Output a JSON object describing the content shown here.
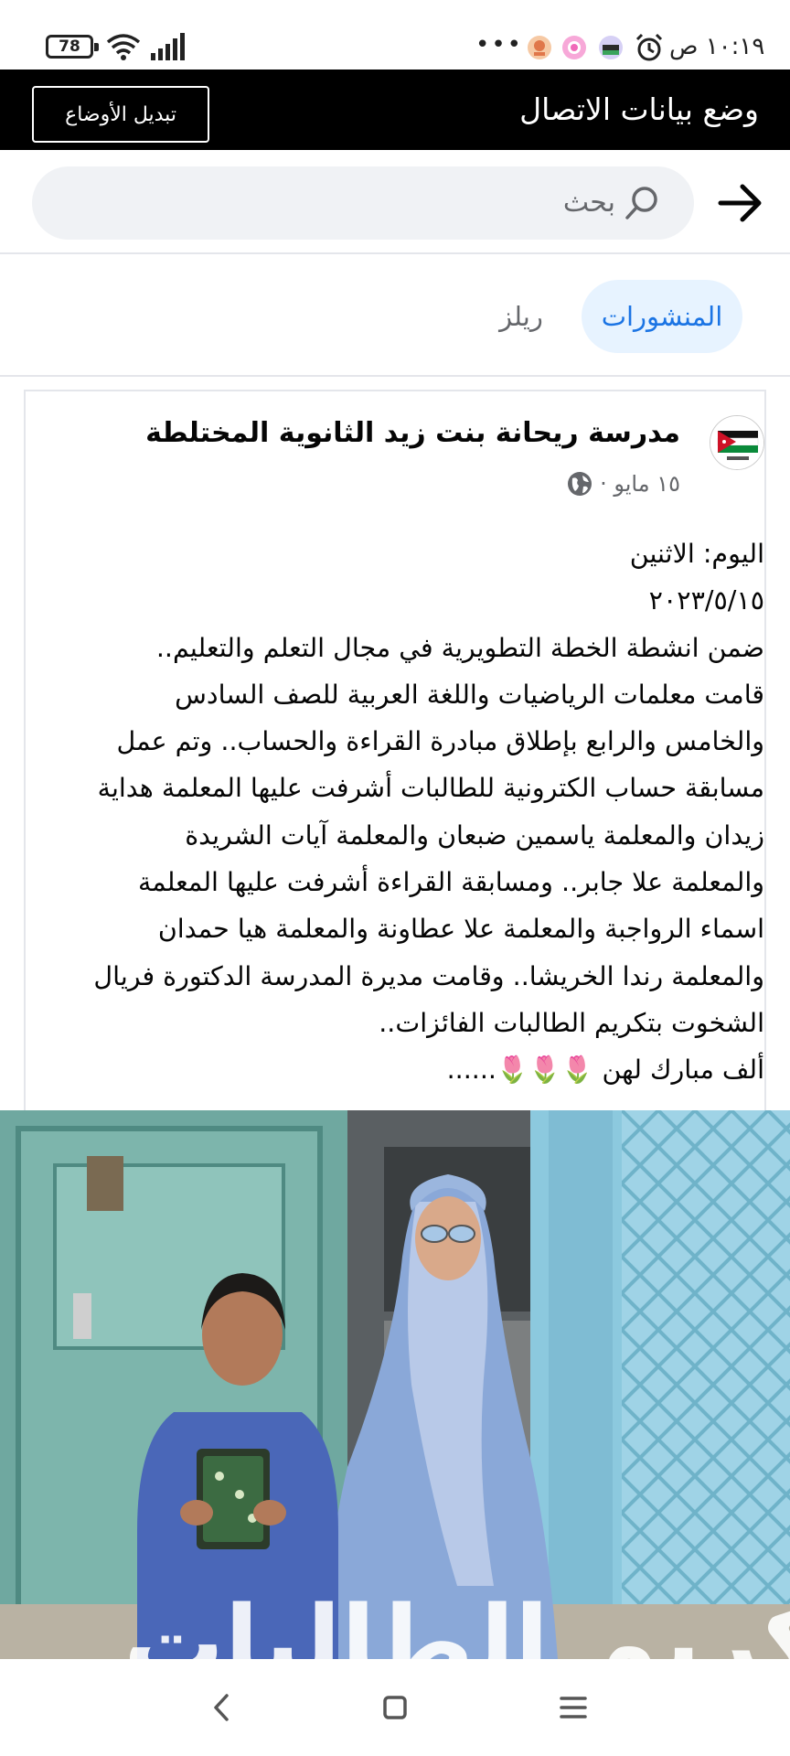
{
  "status_bar": {
    "time": "١٠:١٩ ص",
    "battery": "78",
    "more": "•••",
    "icons": [
      "alarm-icon",
      "app-icon",
      "app-icon",
      "app-icon",
      "wifi-icon",
      "signal-icon",
      "battery-icon"
    ]
  },
  "banner": {
    "title": "وضع بيانات الاتصال",
    "toggle_label": "تبديل الأوضاع"
  },
  "search": {
    "placeholder": "بحث"
  },
  "tabs": [
    {
      "label": "المنشورات",
      "active": true
    },
    {
      "label": "ريلز",
      "active": false
    }
  ],
  "post": {
    "author": "مدرسة ريحانة بنت زيد الثانوية المختلطة",
    "date": "١٥ مايو ·",
    "body": "اليوم: الاثنين\n٢٠٢٣/٥/١٥\nضمن انشطة الخطة التطويرية في مجال التعلم والتعليم..\nقامت معلمات الرياضيات واللغة العربية للصف السادس\nوالخامس والرابع بإطلاق مبادرة القراءة والحساب.. وتم عمل\nمسابقة حساب الكترونية للطالبات أشرفت عليها المعلمة هداية\nزيدان والمعلمة ياسمين ضبعان والمعلمة آيات الشريدة\nوالمعلمة علا جابر.. ومسابقة القراءة أشرفت عليها المعلمة\nاسماء الرواجبة  والمعلمة علا عطاونة والمعلمة هيا حمدان\nوالمعلمة رندا الخريشا.. وقامت مديرة المدرسة الدكتورة فريال\nالشخوت  بتكريم الطالبات الفائزات..\nألف مبارك لهن 🌷🌷🌷......",
    "photo_caption": "بتكريم الطالبات"
  },
  "colors": {
    "accent": "#1b74e4",
    "tab_active_bg": "#e7f3ff",
    "banner_bg": "#000000",
    "search_bg": "#f0f2f5"
  }
}
